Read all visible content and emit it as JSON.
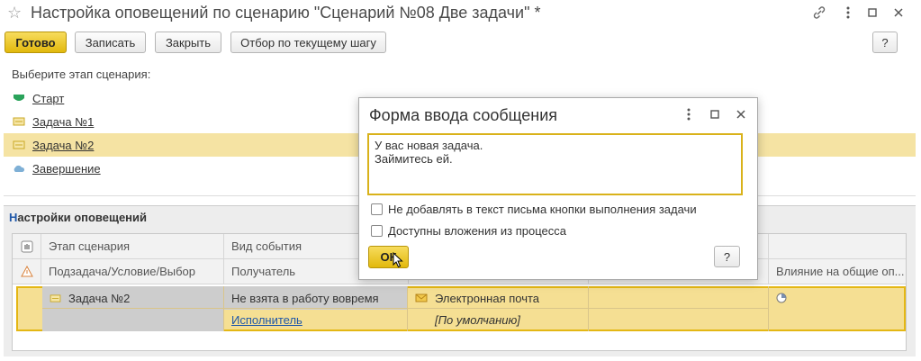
{
  "window": {
    "title": "Настройка оповещений по сценарию \"Сценарий №08 Две задачи\" *",
    "star_icon": "☆"
  },
  "toolbar": {
    "done_label": "Готово",
    "save_label": "Записать",
    "close_label": "Закрыть",
    "filter_label": "Отбор по текущему шагу",
    "help_label": "?"
  },
  "stages": {
    "prompt": "Выберите этап сценария:",
    "items": [
      {
        "label": "Старт",
        "icon": "start-shield-icon"
      },
      {
        "label": "Задача №1",
        "icon": "task-icon"
      },
      {
        "label": "Задача №2",
        "icon": "task-icon",
        "selected": true
      },
      {
        "label": "Завершение",
        "icon": "cloud-icon"
      }
    ]
  },
  "settings": {
    "title_first": "Н",
    "title_rest": "астройки оповещений",
    "headers_row1": [
      "Этап сценария",
      "Вид события",
      "",
      ""
    ],
    "headers_row2": [
      "Подзадача/Условие/Выбор",
      "Получатель",
      "",
      "",
      "Влияние на общие оп..."
    ],
    "row1": {
      "stage": "Задача №2",
      "event": "Не взята в работу вовремя",
      "channel": "Электронная почта"
    },
    "row2": {
      "recipient": "Исполнитель",
      "channel_value": "[По умолчанию]"
    }
  },
  "dialog": {
    "title": "Форма ввода сообщения",
    "message_line1": "У вас новая задача.",
    "message_line2": "Займитесь ей.",
    "checkbox1_label": "Не добавлять в текст письма кнопки выполнения задачи",
    "checkbox2_label": "Доступны вложения из процесса",
    "ok_label": "ОК",
    "help_label": "?"
  },
  "colors": {
    "accent_yellow": "#e2b90d",
    "selection": "#f5e3a3",
    "start_green": "#2aa35b"
  }
}
